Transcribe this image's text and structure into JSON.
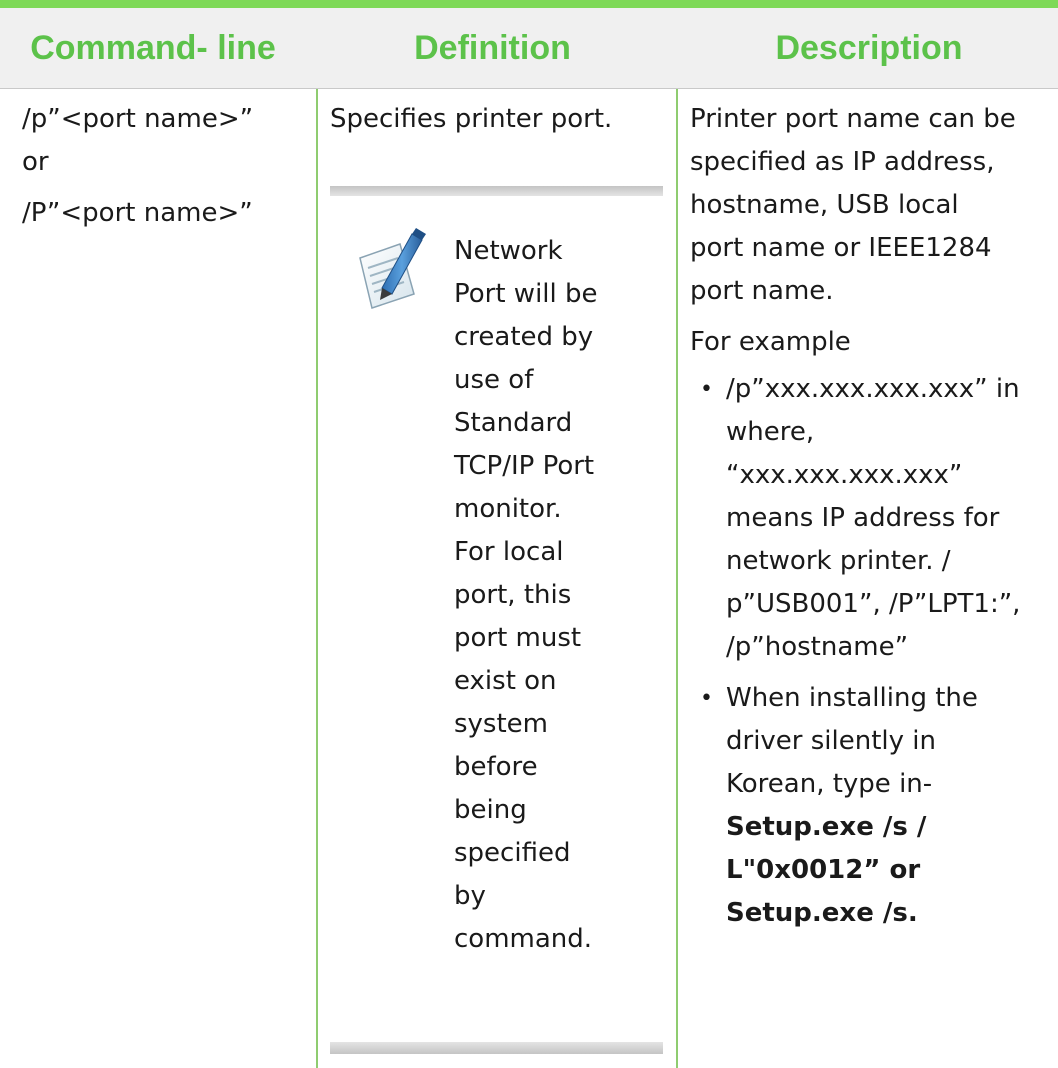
{
  "table": {
    "headers": [
      "Command- line",
      "Definition",
      "Description"
    ],
    "accent_color": "#5cc24a",
    "row": {
      "command_lines": [
        "/p”<port name>”",
        "or",
        "/P”<port name>”"
      ],
      "definition": "Specifies printer port.",
      "note": {
        "icon": "note-pencil-icon",
        "lines": [
          "Network",
          "Port will be",
          "created by",
          "use of",
          "Standard",
          "TCP/IP Port",
          "monitor.",
          "For local",
          "port, this",
          "port must",
          "exist on",
          "system",
          "before",
          "being",
          "specified",
          "by",
          "command."
        ]
      },
      "description": {
        "intro_lines": [
          "Printer port name can be",
          "specified as IP address,",
          "hostname, USB local",
          "port name or IEEE1284",
          "port name."
        ],
        "example_label": "For example",
        "bullet1_lines": [
          "/p”xxx.xxx.xxx.xxx” in",
          "where,",
          "“xxx.xxx.xxx.xxx”",
          "means IP address for",
          "network printer. /",
          "p”USB001”, /P”LPT1:”,",
          "/p”hostname”"
        ],
        "bullet2_lines": [
          "When installing the",
          "driver silently in",
          "Korean, type in-"
        ],
        "bullet2_bold_lines": [
          "Setup.exe /s /",
          "L\"0x0012” or",
          "Setup.exe /s."
        ]
      }
    }
  }
}
